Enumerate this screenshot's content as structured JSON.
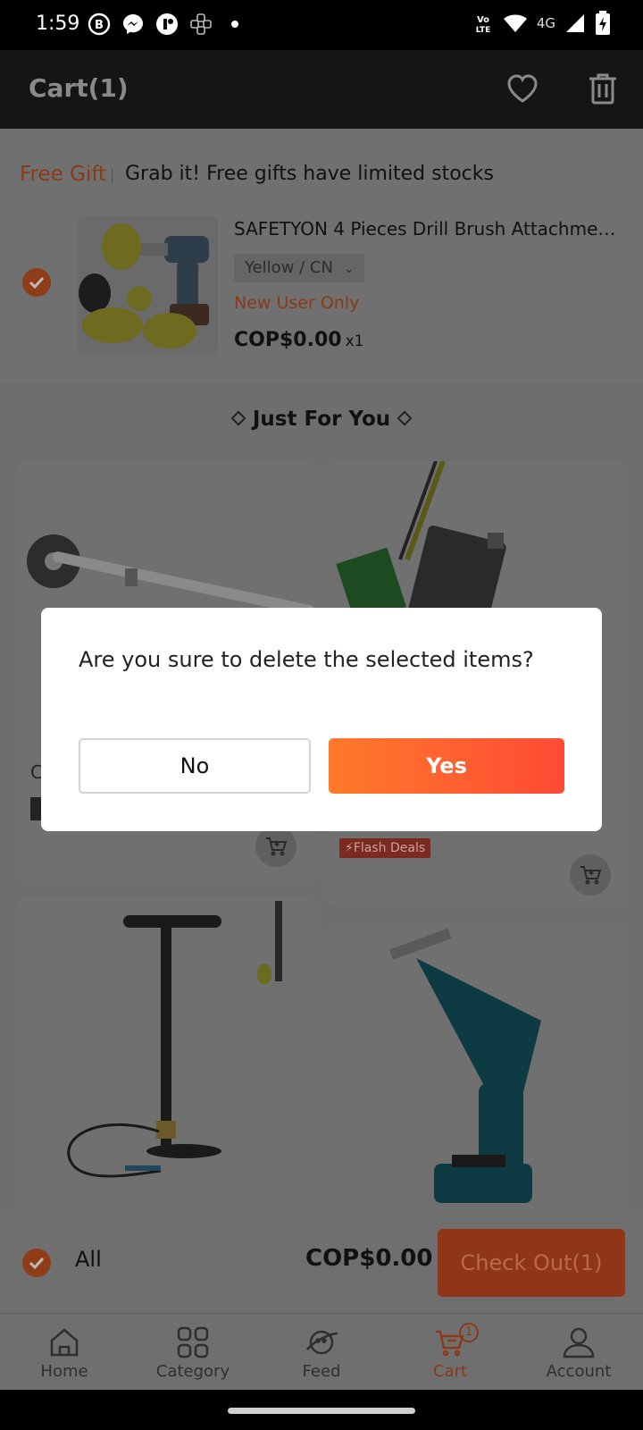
{
  "status_bar": {
    "time": "1:59",
    "network": "4G",
    "volte": "Vo LTE"
  },
  "header": {
    "title": "Cart(1)",
    "icons": [
      "heart-icon",
      "trash-icon"
    ]
  },
  "free_gift": {
    "tag": "Free Gift",
    "headline": "Grab it! Free gifts have limited stocks",
    "item": {
      "name": "SAFETYON 4 Pieces Drill Brush Attachment...",
      "variant": "Yellow / CN",
      "note": "New User Only",
      "price": "COP$0.00",
      "quantity": "x1",
      "selected": true
    }
  },
  "just_for_you": {
    "title": "Just For You",
    "cards": [
      {
        "name": "wheel-cleaner-product",
        "partial_text": "C",
        "has_cart_button": true
      },
      {
        "name": "laser-module-product",
        "badge": "Flash Deals",
        "has_cart_button": true
      },
      {
        "name": "hand-pump-product"
      },
      {
        "name": "reciprocating-saw-product"
      }
    ]
  },
  "summary": {
    "select_all_label": "All",
    "total": "COP$0.00",
    "checkout_label": "Check Out(1)"
  },
  "tabs": [
    {
      "label": "Home",
      "icon": "home-icon"
    },
    {
      "label": "Category",
      "icon": "category-icon"
    },
    {
      "label": "Feed",
      "icon": "feed-icon"
    },
    {
      "label": "Cart",
      "icon": "cart-icon",
      "badge": "1",
      "active": true
    },
    {
      "label": "Account",
      "icon": "account-icon"
    }
  ],
  "dialog": {
    "message": "Are you sure to delete the selected items?",
    "no_label": "No",
    "yes_label": "Yes"
  },
  "colors": {
    "accent": "#ff5a30",
    "dialog_yes_gradient_start": "#ff7a2a",
    "dialog_yes_gradient_end": "#ff4a36",
    "overlay": "rgba(0,0,0,0.55)"
  }
}
